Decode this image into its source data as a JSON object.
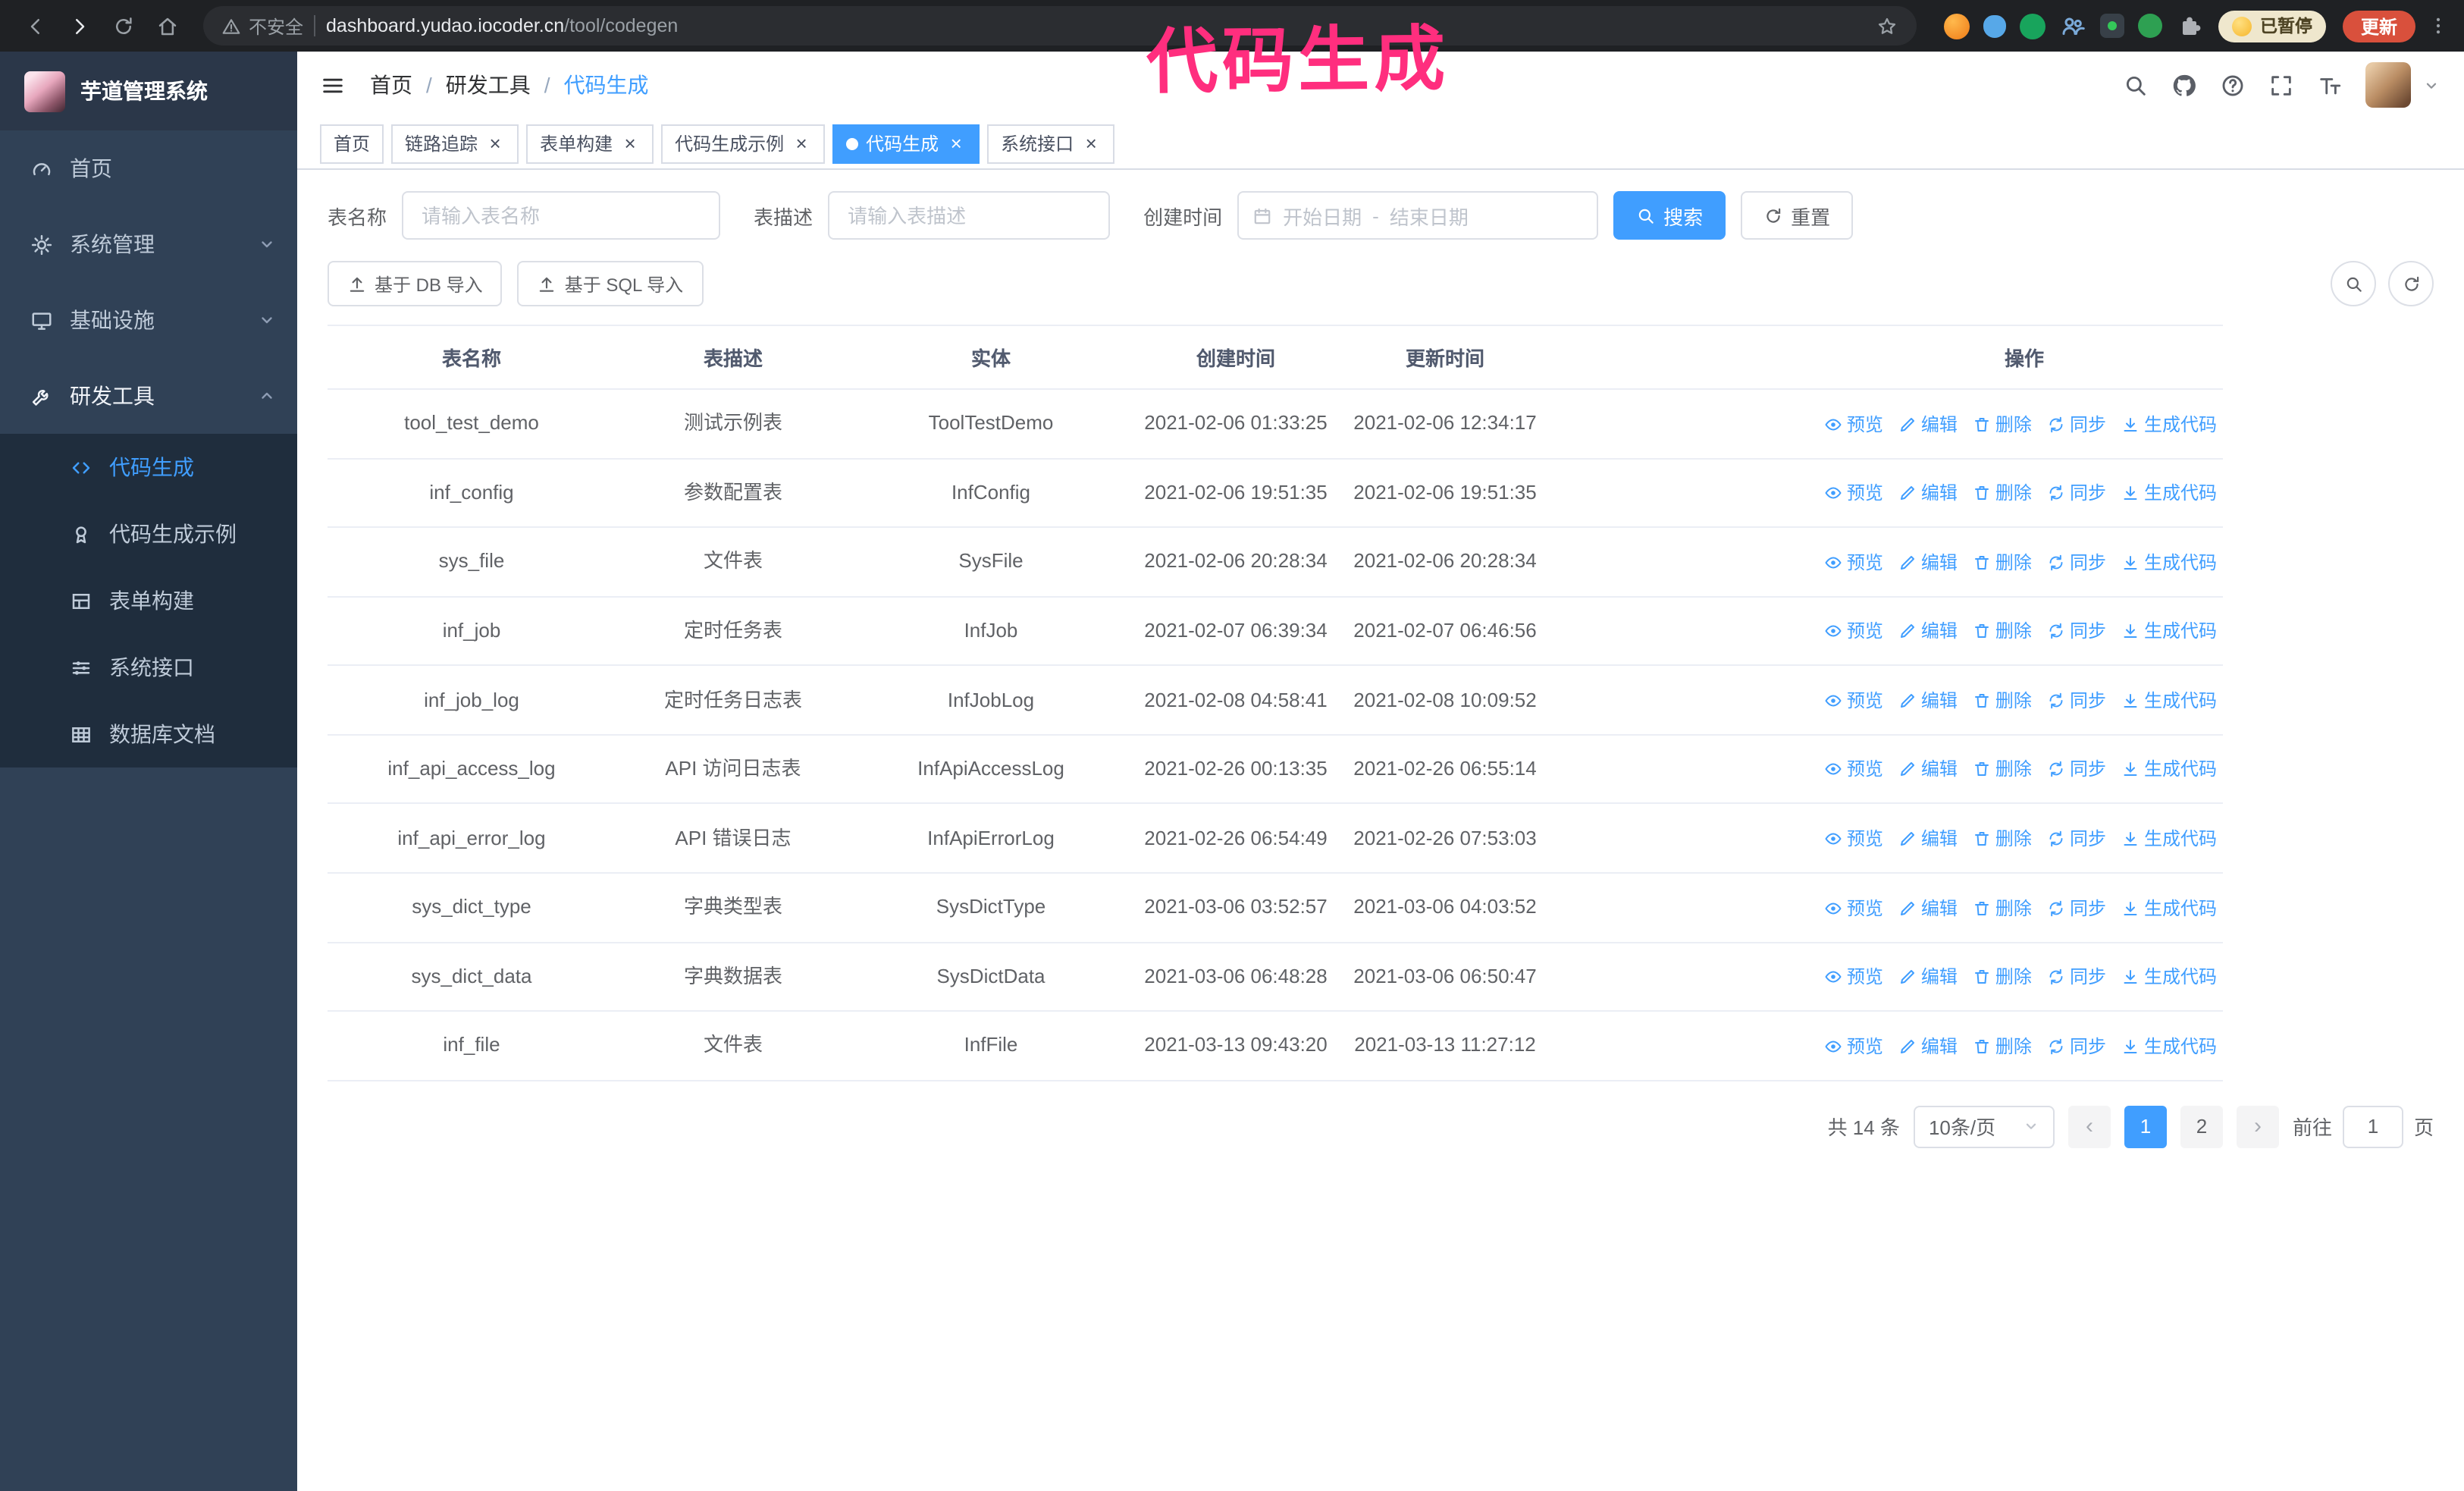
{
  "annotation": {
    "text": "代码生成",
    "color": "#ff2e7e"
  },
  "icons": {
    "close": "×"
  },
  "browser": {
    "security_label": "不安全",
    "url_host": "dashboard.yudao.iocoder.cn",
    "url_path": "/tool/codegen",
    "paused_badge": "已暂停",
    "update_button": "更新"
  },
  "sidebar": {
    "logo_title": "芋道管理系统",
    "items": [
      {
        "label": "首页",
        "icon": "gauge-icon"
      },
      {
        "label": "系统管理",
        "icon": "gear-icon",
        "caret": "down"
      },
      {
        "label": "基础设施",
        "icon": "monitor-icon",
        "caret": "down"
      },
      {
        "label": "研发工具",
        "icon": "tool-icon",
        "caret": "up",
        "expanded": true
      }
    ],
    "subitems": [
      {
        "label": "代码生成",
        "icon": "code-icon",
        "active": true
      },
      {
        "label": "代码生成示例",
        "icon": "example-badge-icon"
      },
      {
        "label": "表单构建",
        "icon": "form-grid-icon"
      },
      {
        "label": "系统接口",
        "icon": "sliders-icon"
      },
      {
        "label": "数据库文档",
        "icon": "database-doc-icon"
      }
    ]
  },
  "breadcrumb": {
    "items": [
      "首页",
      "研发工具",
      "代码生成"
    ],
    "separator": "/"
  },
  "tabs": [
    {
      "label": "首页",
      "closable": false,
      "active": false
    },
    {
      "label": "链路追踪",
      "closable": true,
      "active": false
    },
    {
      "label": "表单构建",
      "closable": true,
      "active": false
    },
    {
      "label": "代码生成示例",
      "closable": true,
      "active": false
    },
    {
      "label": "代码生成",
      "closable": true,
      "active": true
    },
    {
      "label": "系统接口",
      "closable": true,
      "active": false
    }
  ],
  "filters": {
    "name_label": "表名称",
    "name_placeholder": "请输入表名称",
    "desc_label": "表描述",
    "desc_placeholder": "请输入表描述",
    "time_label": "创建时间",
    "start_placeholder": "开始日期",
    "range_separator": "-",
    "end_placeholder": "结束日期",
    "search_button": "搜索",
    "reset_button": "重置"
  },
  "toolbar": {
    "import_db_button": "基于 DB 导入",
    "import_sql_button": "基于 SQL 导入"
  },
  "table": {
    "columns": [
      "表名称",
      "表描述",
      "实体",
      "创建时间",
      "更新时间",
      "操作"
    ],
    "actions": [
      {
        "label": "预览",
        "icon": "eye-icon",
        "name": "preview-link"
      },
      {
        "label": "编辑",
        "icon": "edit-icon",
        "name": "edit-link"
      },
      {
        "label": "删除",
        "icon": "delete-icon",
        "name": "delete-link"
      },
      {
        "label": "同步",
        "icon": "sync-icon",
        "name": "sync-link"
      },
      {
        "label": "生成代码",
        "icon": "download-icon",
        "name": "generate-code-link"
      }
    ],
    "rows": [
      {
        "name": "tool_test_demo",
        "desc": "测试示例表",
        "entity": "ToolTestDemo",
        "created": "2021-02-06 01:33:25",
        "updated": "2021-02-06 12:34:17"
      },
      {
        "name": "inf_config",
        "desc": "参数配置表",
        "entity": "InfConfig",
        "created": "2021-02-06 19:51:35",
        "updated": "2021-02-06 19:51:35"
      },
      {
        "name": "sys_file",
        "desc": "文件表",
        "entity": "SysFile",
        "created": "2021-02-06 20:28:34",
        "updated": "2021-02-06 20:28:34"
      },
      {
        "name": "inf_job",
        "desc": "定时任务表",
        "entity": "InfJob",
        "created": "2021-02-07 06:39:34",
        "updated": "2021-02-07 06:46:56"
      },
      {
        "name": "inf_job_log",
        "desc": "定时任务日志表",
        "entity": "InfJobLog",
        "created": "2021-02-08 04:58:41",
        "updated": "2021-02-08 10:09:52"
      },
      {
        "name": "inf_api_access_log",
        "desc": "API 访问日志表",
        "entity": "InfApiAccessLog",
        "created": "2021-02-26 00:13:35",
        "updated": "2021-02-26 06:55:14"
      },
      {
        "name": "inf_api_error_log",
        "desc": "API 错误日志",
        "entity": "InfApiErrorLog",
        "created": "2021-02-26 06:54:49",
        "updated": "2021-02-26 07:53:03"
      },
      {
        "name": "sys_dict_type",
        "desc": "字典类型表",
        "entity": "SysDictType",
        "created": "2021-03-06 03:52:57",
        "updated": "2021-03-06 04:03:52"
      },
      {
        "name": "sys_dict_data",
        "desc": "字典数据表",
        "entity": "SysDictData",
        "created": "2021-03-06 06:48:28",
        "updated": "2021-03-06 06:50:47"
      },
      {
        "name": "inf_file",
        "desc": "文件表",
        "entity": "InfFile",
        "created": "2021-03-13 09:43:20",
        "updated": "2021-03-13 11:27:12"
      }
    ]
  },
  "pagination": {
    "total": "共 14 条",
    "page_size": "10条/页",
    "prev": "‹",
    "next": "›",
    "pages": [
      "1",
      "2"
    ],
    "active_page": "1",
    "goto_label": "前往",
    "goto_value": "1",
    "goto_suffix": "页"
  }
}
